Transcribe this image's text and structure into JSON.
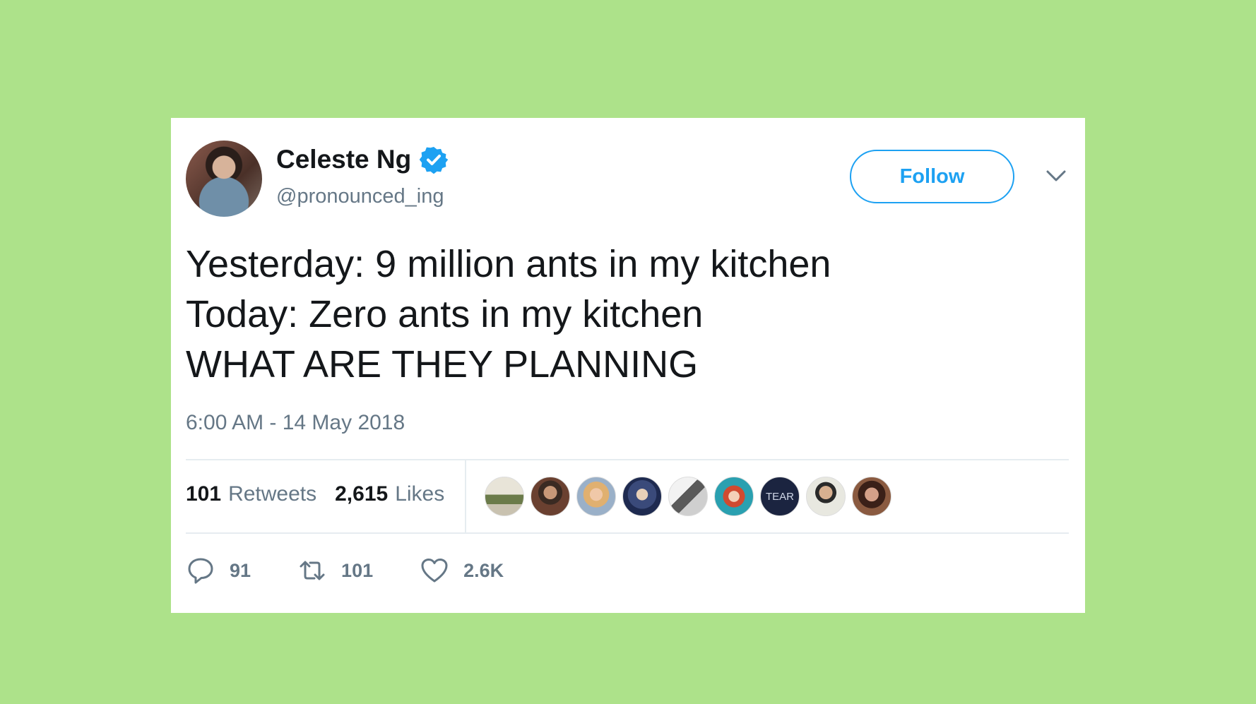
{
  "tweet": {
    "author_name": "Celeste Ng",
    "handle": "@pronounced_ing",
    "follow_label": "Follow",
    "lines": [
      "Yesterday: 9 million ants in my kitchen",
      "Today: Zero ants in my kitchen",
      "WHAT ARE THEY PLANNING"
    ],
    "timestamp": "6:00 AM - 14 May 2018",
    "retweets_count": "101",
    "retweets_label": "Retweets",
    "likes_count": "2,615",
    "likes_label": "Likes",
    "likers_extra_text": "TEAR",
    "actions": {
      "reply_count": "91",
      "retweet_count": "101",
      "like_count": "2.6K"
    }
  },
  "colors": {
    "background": "#ade28a",
    "accent": "#1da1f2",
    "text": "#14171a",
    "muted": "#657786"
  },
  "icons": [
    "verified-badge-icon",
    "chevron-down-icon",
    "reply-icon",
    "retweet-icon",
    "heart-icon"
  ]
}
